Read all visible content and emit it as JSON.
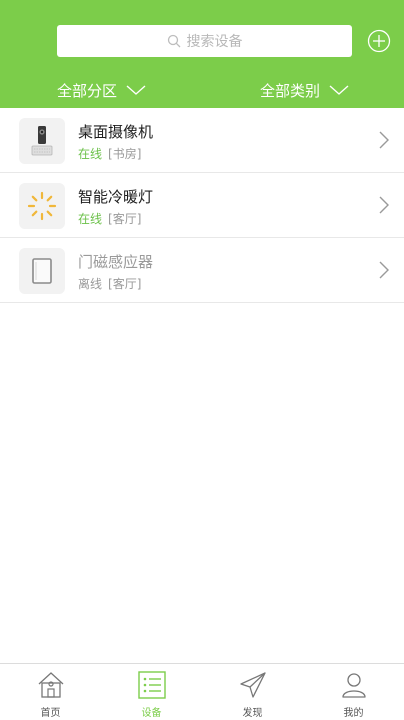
{
  "header": {
    "search_placeholder": "搜索设备",
    "filter_area": "全部分区",
    "filter_category": "全部类别"
  },
  "devices": [
    {
      "name": "桌面摄像机",
      "status": "在线",
      "room": "[书房]",
      "online": true,
      "icon": "camera-icon"
    },
    {
      "name": "智能冷暖灯",
      "status": "在线",
      "room": "[客厅]",
      "online": true,
      "icon": "lamp-icon"
    },
    {
      "name": "门磁感应器",
      "status": "离线",
      "room": "[客厅]",
      "online": false,
      "icon": "door-sensor-icon"
    }
  ],
  "tabbar": {
    "items": [
      {
        "label": "首页",
        "icon": "home-icon",
        "active": false
      },
      {
        "label": "设备",
        "icon": "device-list-icon",
        "active": true
      },
      {
        "label": "发现",
        "icon": "paper-plane-icon",
        "active": false
      },
      {
        "label": "我的",
        "icon": "user-icon",
        "active": false
      }
    ]
  },
  "colors": {
    "accent": "#7ccd4a",
    "online": "#6cc14a",
    "muted": "#999999"
  }
}
